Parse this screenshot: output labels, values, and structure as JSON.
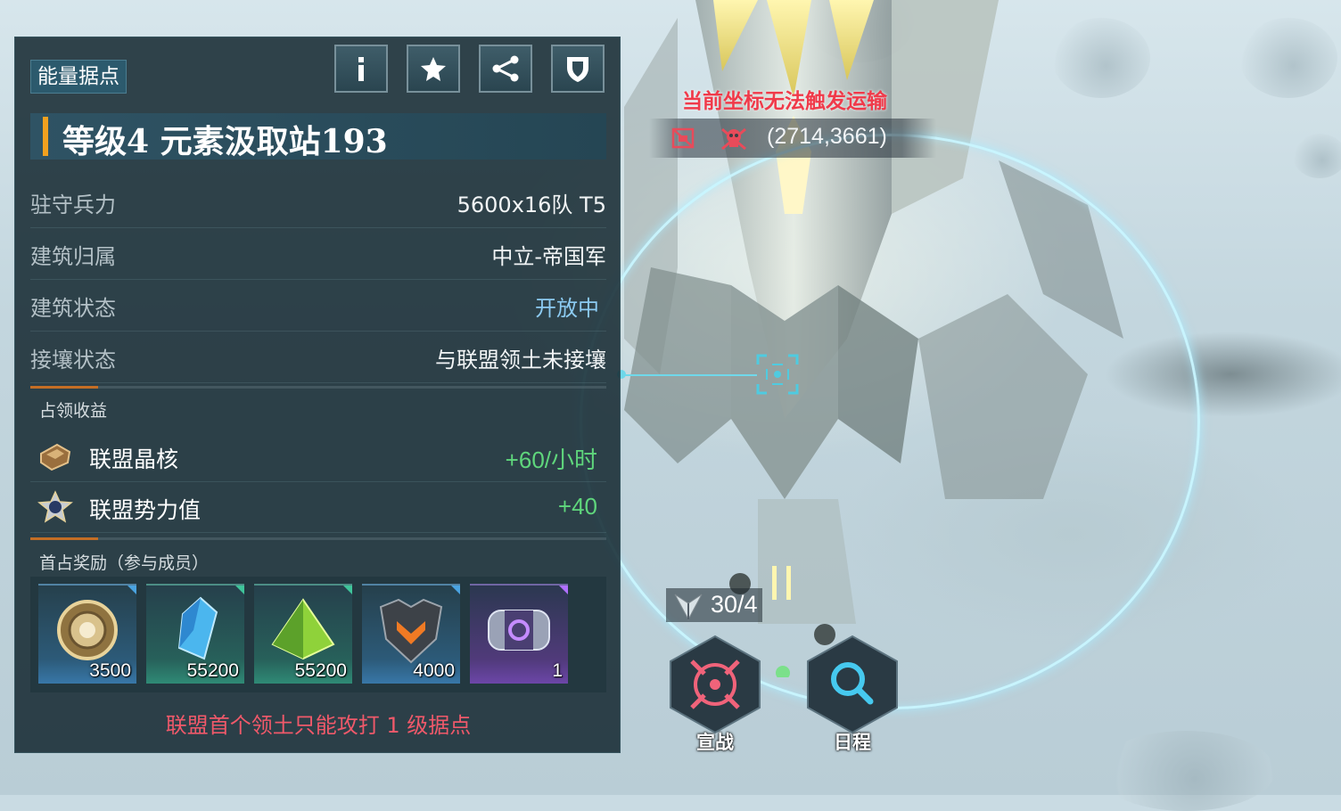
{
  "panel": {
    "tag": "能量据点",
    "title": "等级4  元素汲取站193",
    "rows": [
      {
        "label": "驻守兵力",
        "value": "5600x16队 T5"
      },
      {
        "label": "建筑归属",
        "value": "中立-帝国军"
      },
      {
        "label": "建筑状态",
        "value": "开放中"
      },
      {
        "label": "接壤状态",
        "value": "与联盟领土未接壤"
      }
    ],
    "income_title": "占领收益",
    "income": [
      {
        "label": "联盟晶核",
        "value": "+60/小时",
        "icon": "crystal-core-icon"
      },
      {
        "label": "联盟势力值",
        "value": "+40",
        "icon": "influence-badge-icon"
      }
    ],
    "reward_title": "首占奖励（参与成员）",
    "rewards": [
      {
        "count": "3500",
        "icon": "gold-medal-coin",
        "rarity": "blue"
      },
      {
        "count": "55200",
        "icon": "blue-crystal",
        "rarity": "green"
      },
      {
        "count": "55200",
        "icon": "green-pyramid-crystal",
        "rarity": "green"
      },
      {
        "count": "4000",
        "icon": "dark-emblem",
        "rarity": "blue"
      },
      {
        "count": "1",
        "icon": "purple-capsule-chest",
        "rarity": "purple"
      }
    ],
    "footer_note": "联盟首个领土只能攻打 1 级据点"
  },
  "map": {
    "warning": "当前坐标无法触发运输",
    "coords": "(2714,3661)",
    "troop_count": "30/4",
    "declare_war_label": "宣战",
    "schedule_label": "日程"
  },
  "colors": {
    "accent_orange": "#f1a11f",
    "income_green": "#5fd67c",
    "status_blue": "#8ccbf2",
    "warning_red": "#f03a4a",
    "note_red": "#f0596a"
  }
}
